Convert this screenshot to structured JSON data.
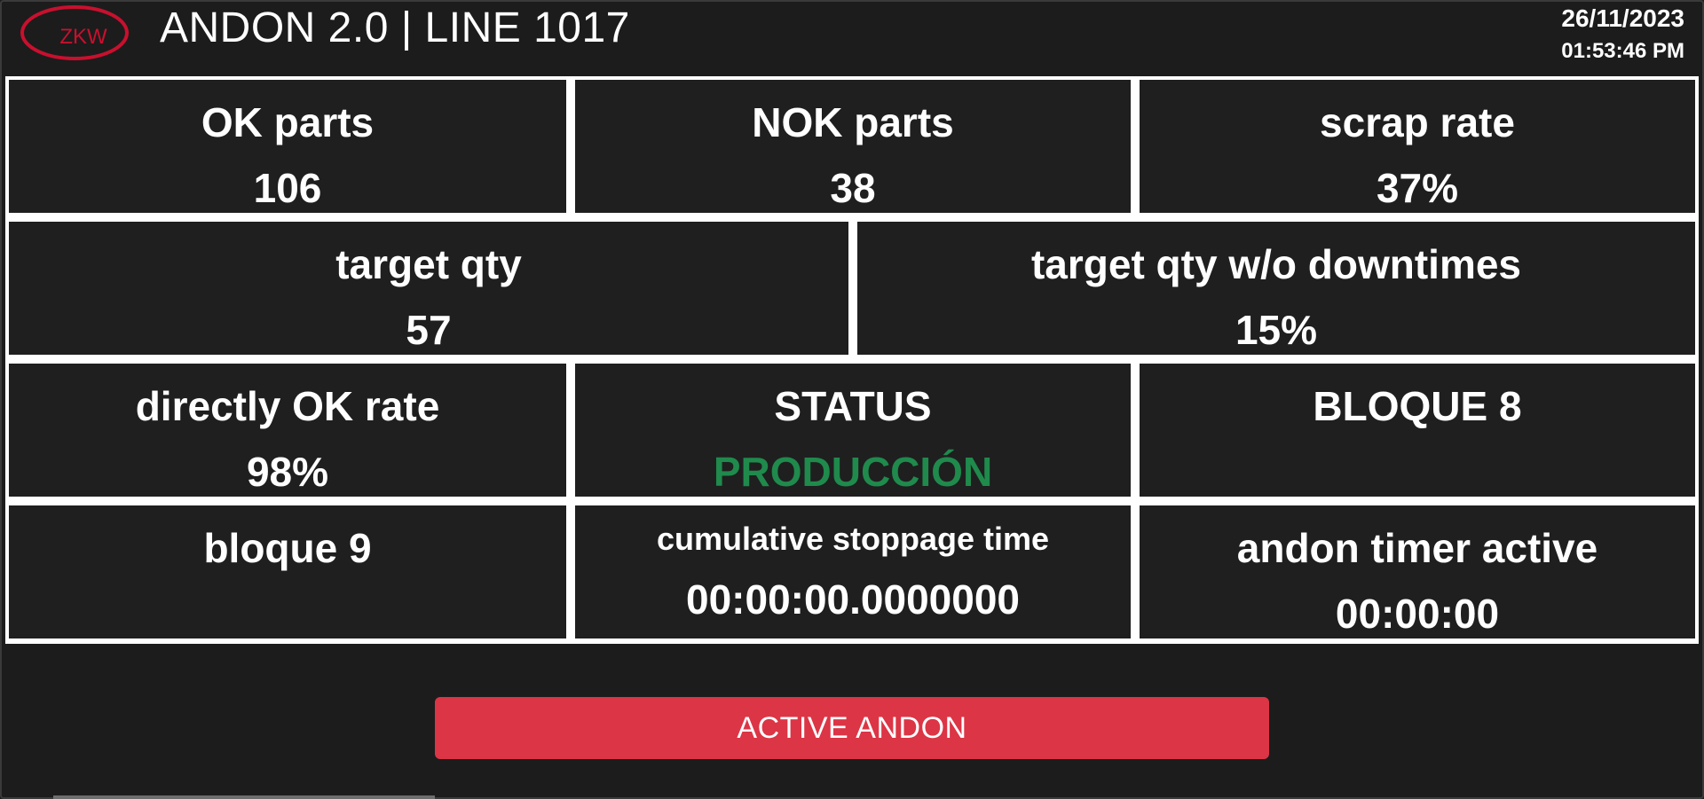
{
  "header": {
    "logo_text": "ZKW",
    "title": "ANDON 2.0 | LINE 1017",
    "date": "26/11/2023",
    "time": "01:53:46 PM"
  },
  "metrics": {
    "ok_parts": {
      "label": "OK parts",
      "value": "106"
    },
    "nok_parts": {
      "label": "NOK parts",
      "value": "38"
    },
    "scrap_rate": {
      "label": "scrap rate",
      "value": "37%"
    },
    "target_qty": {
      "label": "target qty",
      "value": "57"
    },
    "target_qty_wo": {
      "label": "target qty w/o downtimes",
      "value": "15%"
    },
    "directly_ok_rate": {
      "label": "directly OK rate",
      "value": "98%"
    },
    "status": {
      "label": "STATUS",
      "value": "PRODUCCIÓN"
    },
    "bloque8": {
      "label": "BLOQUE 8",
      "value": ""
    },
    "bloque9": {
      "label": "bloque 9",
      "value": ""
    },
    "stoppage": {
      "label": "cumulative stoppage time",
      "value": "00:00:00.0000000"
    },
    "andon_timer": {
      "label": "andon timer active",
      "value": "00:00:00"
    }
  },
  "actions": {
    "active_andon": "ACTIVE ANDON"
  },
  "colors": {
    "status_ok": "#1f8a4c",
    "andon_button": "#dc3545",
    "logo_red": "#c8102e"
  }
}
